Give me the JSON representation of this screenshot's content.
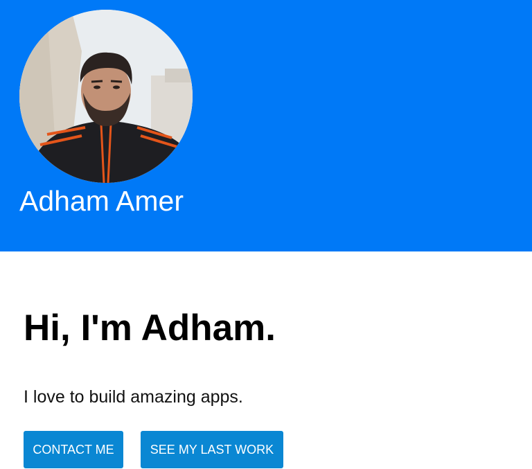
{
  "header": {
    "name": "Adham Amer",
    "background_color": "#0079F7",
    "avatar": "profile-photo"
  },
  "main": {
    "greeting": "Hi, I'm Adham.",
    "tagline": "I love to build amazing apps."
  },
  "buttons": {
    "contact_label": "CONTACT ME",
    "work_label": "SEE MY LAST WORK",
    "color": "#0A87D3"
  }
}
